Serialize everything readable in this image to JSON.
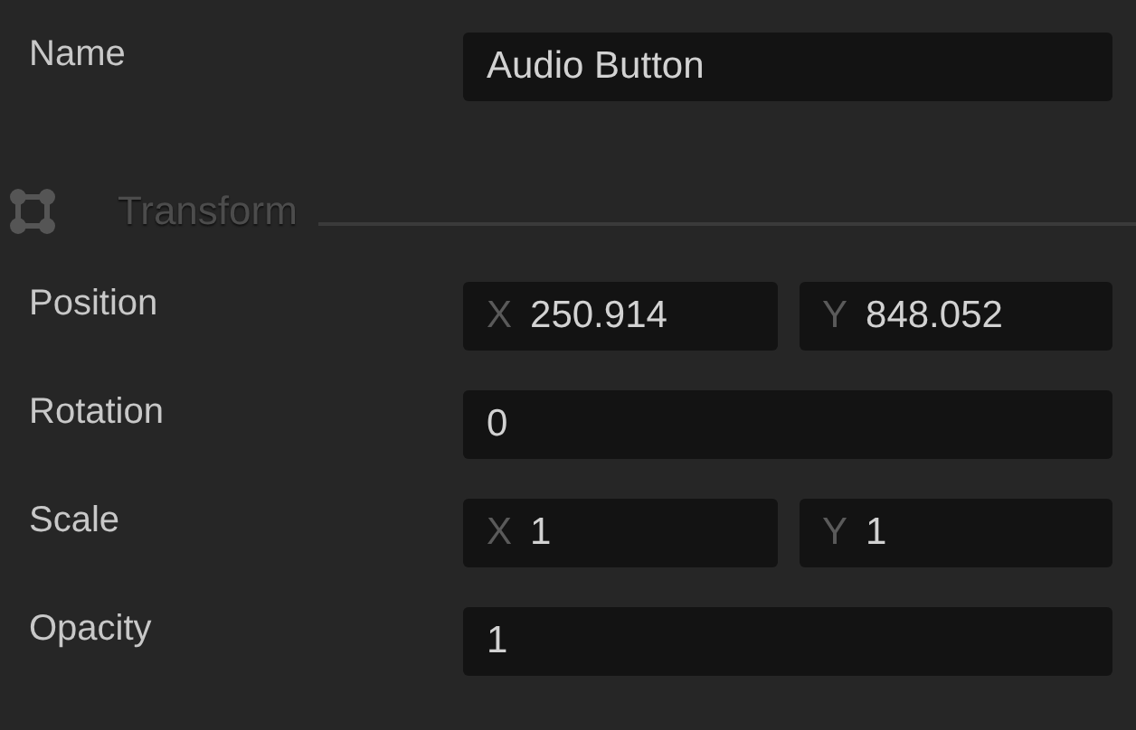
{
  "name": {
    "label": "Name",
    "value": "Audio Button"
  },
  "section": {
    "title": "Transform"
  },
  "rows": [
    {
      "kind": "vector",
      "label": "Position",
      "fields": [
        {
          "axis": "X",
          "value": "250.914"
        },
        {
          "axis": "Y",
          "value": "848.052"
        }
      ]
    },
    {
      "kind": "scalar",
      "label": "Rotation",
      "value": "0"
    },
    {
      "kind": "vector",
      "label": "Scale",
      "fields": [
        {
          "axis": "X",
          "value": "1"
        },
        {
          "axis": "Y",
          "value": "1"
        }
      ]
    },
    {
      "kind": "scalar",
      "label": "Opacity",
      "value": "1"
    }
  ]
}
